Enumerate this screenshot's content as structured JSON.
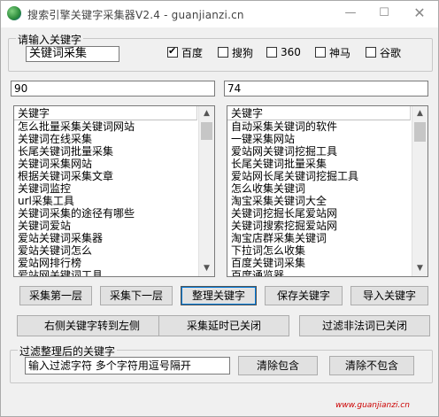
{
  "window": {
    "title": "搜索引擎关键字采集器V2.4 - guanjianzi.cn",
    "min_glyph": "—",
    "max_glyph": "☐",
    "close_glyph": "✕"
  },
  "input_group": {
    "title": "请输入关键字",
    "keyword_value": "关键词采集",
    "engines": [
      {
        "label": "百度",
        "checked": true
      },
      {
        "label": "搜狗",
        "checked": false
      },
      {
        "label": "360",
        "checked": false
      },
      {
        "label": "神马",
        "checked": false
      },
      {
        "label": "谷歌",
        "checked": false
      }
    ]
  },
  "counts": {
    "left": "90",
    "right": "74"
  },
  "left_list": {
    "header": "关键字",
    "items": [
      "怎么批量采集关键词网站",
      "关键词在线采集",
      "长尾关键词批量采集",
      "关键词采集网站",
      "根据关键词采集文章",
      "关键词监控",
      "url采集工具",
      "关键词采集的途径有哪些",
      "关键词爱站",
      "爱站关键词采集器",
      "爱站关键词怎么",
      "爱站网排行榜",
      "爱站网关键词工具"
    ]
  },
  "right_list": {
    "header": "关键字",
    "items": [
      "自动采集关键词的软件",
      "一键采集网站",
      "爱站网关键词挖掘工具",
      "长尾关键词批量采集",
      "爱站网长尾关键词挖掘工具",
      "怎么收集关键词",
      "淘宝采集关键词大全",
      "关键词挖掘长尾爱站网",
      "关键词搜索挖掘爱站网",
      "淘宝店群采集关键词",
      "下拉词怎么收集",
      "百度关键词采集",
      "百度通览器"
    ]
  },
  "buttons": {
    "collect_first": "采集第一层",
    "collect_next": "采集下一层",
    "organize": "整理关键字",
    "save": "保存关键字",
    "import": "导入关键字",
    "move_right_to_left": "右侧关键字转到左侧",
    "delay": "采集延时已关闭",
    "filter_illegal": "过滤非法词已关闭"
  },
  "filter_group": {
    "title": "过滤整理后的关键字",
    "input_value": "输入过滤字符 多个字符用逗号隔开",
    "clear_include": "清除包含",
    "clear_exclude": "清除不包含"
  },
  "watermark": "www.guanjianzi.cn"
}
